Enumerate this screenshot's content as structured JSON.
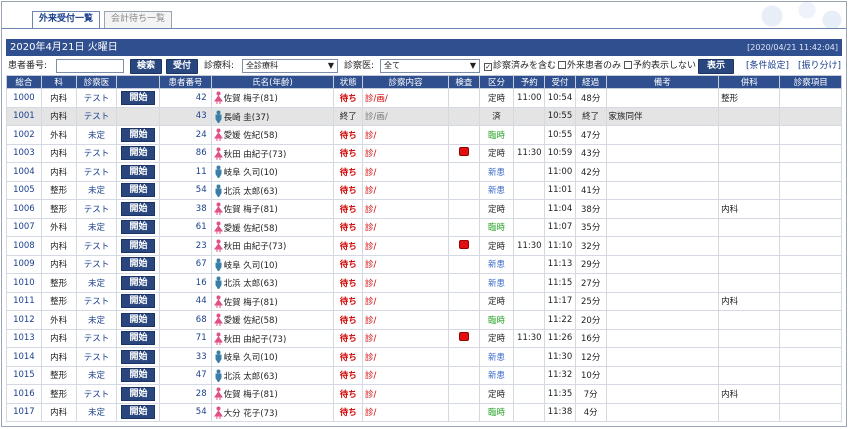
{
  "tabs": [
    {
      "label": "外来受付一覧",
      "active": true
    },
    {
      "label": "会計待ち一覧",
      "active": false
    }
  ],
  "title": "2020年4月21日 火曜日",
  "timestamp": "[2020/04/21 11:42:04]",
  "filter": {
    "patient_no_label": "患者番号:",
    "patient_no_value": "",
    "search_label": "検索",
    "reception_label": "受付",
    "dept_label": "診療科:",
    "dept_value": "全診療科",
    "doctor_label": "診察医:",
    "doctor_value": "全て",
    "cb_include_done": "診察済みを含む",
    "cb_include_done_checked": true,
    "cb_outpatient_only": "外来患者のみ",
    "cb_outpatient_only_checked": false,
    "cb_hide_appointments": "予約表示しない",
    "cb_hide_appointments_checked": false,
    "display_label": "表示",
    "cond_settings": "[条件設定]",
    "allocate": "[振り分け]"
  },
  "columns": [
    "総合",
    "科",
    "診察医",
    "",
    "患者番号",
    "氏名(年齢)",
    "状態",
    "診察内容",
    "検査",
    "区分",
    "予約",
    "受付",
    "経過",
    "備考",
    "併科",
    "診察項目"
  ],
  "start_label": "開始",
  "rows": [
    {
      "no": "1000",
      "dept": "内科",
      "doctor": "テスト",
      "start": true,
      "pid": "42",
      "sex": "f",
      "name": "佐賀 梅子(81)",
      "status": "待ち",
      "content": "診/画/",
      "exam": false,
      "category": "定時",
      "category_type": "normal",
      "appt": "11:00",
      "reception": "10:54",
      "elapsed": "48分",
      "note": "",
      "co_dept": "整形",
      "items": "",
      "done": false
    },
    {
      "no": "1001",
      "dept": "内科",
      "doctor": "テスト",
      "start": false,
      "pid": "43",
      "sex": "m",
      "name": "長崎 圭(37)",
      "status": "終了",
      "content": "診/画/",
      "exam": false,
      "category": "済",
      "category_type": "normal",
      "appt": "",
      "reception": "10:55",
      "elapsed": "終了",
      "note": "家族同伴",
      "co_dept": "",
      "items": "",
      "done": true
    },
    {
      "no": "1002",
      "dept": "外科",
      "doctor": "未定",
      "start": true,
      "pid": "24",
      "sex": "f",
      "name": "愛媛 佐紀(58)",
      "status": "待ち",
      "content": "診/",
      "exam": false,
      "category": "臨時",
      "category_type": "temp",
      "appt": "",
      "reception": "10:55",
      "elapsed": "47分",
      "note": "",
      "co_dept": "",
      "items": "",
      "done": false
    },
    {
      "no": "1003",
      "dept": "内科",
      "doctor": "テスト",
      "start": true,
      "pid": "86",
      "sex": "f",
      "name": "秋田 由紀子(73)",
      "status": "待ち",
      "content": "診/",
      "exam": true,
      "category": "定時",
      "category_type": "normal",
      "appt": "11:30",
      "reception": "10:59",
      "elapsed": "43分",
      "note": "",
      "co_dept": "",
      "items": "",
      "done": false
    },
    {
      "no": "1004",
      "dept": "内科",
      "doctor": "テスト",
      "start": true,
      "pid": "11",
      "sex": "m",
      "name": "岐阜 久司(10)",
      "status": "待ち",
      "content": "診/",
      "exam": false,
      "category": "新患",
      "category_type": "new",
      "appt": "",
      "reception": "11:00",
      "elapsed": "42分",
      "note": "",
      "co_dept": "",
      "items": "",
      "done": false
    },
    {
      "no": "1005",
      "dept": "整形",
      "doctor": "未定",
      "start": true,
      "pid": "54",
      "sex": "m",
      "name": "北浜 太郎(63)",
      "status": "待ち",
      "content": "診/",
      "exam": false,
      "category": "新患",
      "category_type": "new",
      "appt": "",
      "reception": "11:01",
      "elapsed": "41分",
      "note": "",
      "co_dept": "",
      "items": "",
      "done": false
    },
    {
      "no": "1006",
      "dept": "整形",
      "doctor": "テスト",
      "start": true,
      "pid": "38",
      "sex": "f",
      "name": "佐賀 梅子(81)",
      "status": "待ち",
      "content": "診/",
      "exam": false,
      "category": "定時",
      "category_type": "normal",
      "appt": "",
      "reception": "11:04",
      "elapsed": "38分",
      "note": "",
      "co_dept": "内科",
      "items": "",
      "done": false
    },
    {
      "no": "1007",
      "dept": "外科",
      "doctor": "未定",
      "start": true,
      "pid": "61",
      "sex": "f",
      "name": "愛媛 佐紀(58)",
      "status": "待ち",
      "content": "診/",
      "exam": false,
      "category": "臨時",
      "category_type": "temp",
      "appt": "",
      "reception": "11:07",
      "elapsed": "35分",
      "note": "",
      "co_dept": "",
      "items": "",
      "done": false
    },
    {
      "no": "1008",
      "dept": "内科",
      "doctor": "テスト",
      "start": true,
      "pid": "23",
      "sex": "f",
      "name": "秋田 由紀子(73)",
      "status": "待ち",
      "content": "診/",
      "exam": true,
      "category": "定時",
      "category_type": "normal",
      "appt": "11:30",
      "reception": "11:10",
      "elapsed": "32分",
      "note": "",
      "co_dept": "",
      "items": "",
      "done": false
    },
    {
      "no": "1009",
      "dept": "内科",
      "doctor": "テスト",
      "start": true,
      "pid": "67",
      "sex": "m",
      "name": "岐阜 久司(10)",
      "status": "待ち",
      "content": "診/",
      "exam": false,
      "category": "新患",
      "category_type": "new",
      "appt": "",
      "reception": "11:13",
      "elapsed": "29分",
      "note": "",
      "co_dept": "",
      "items": "",
      "done": false
    },
    {
      "no": "1010",
      "dept": "整形",
      "doctor": "未定",
      "start": true,
      "pid": "16",
      "sex": "m",
      "name": "北浜 太郎(63)",
      "status": "待ち",
      "content": "診/",
      "exam": false,
      "category": "新患",
      "category_type": "new",
      "appt": "",
      "reception": "11:15",
      "elapsed": "27分",
      "note": "",
      "co_dept": "",
      "items": "",
      "done": false
    },
    {
      "no": "1011",
      "dept": "整形",
      "doctor": "テスト",
      "start": true,
      "pid": "44",
      "sex": "f",
      "name": "佐賀 梅子(81)",
      "status": "待ち",
      "content": "診/",
      "exam": false,
      "category": "定時",
      "category_type": "normal",
      "appt": "",
      "reception": "11:17",
      "elapsed": "25分",
      "note": "",
      "co_dept": "内科",
      "items": "",
      "done": false
    },
    {
      "no": "1012",
      "dept": "外科",
      "doctor": "未定",
      "start": true,
      "pid": "68",
      "sex": "f",
      "name": "愛媛 佐紀(58)",
      "status": "待ち",
      "content": "診/",
      "exam": false,
      "category": "臨時",
      "category_type": "temp",
      "appt": "",
      "reception": "11:22",
      "elapsed": "20分",
      "note": "",
      "co_dept": "",
      "items": "",
      "done": false
    },
    {
      "no": "1013",
      "dept": "内科",
      "doctor": "テスト",
      "start": true,
      "pid": "71",
      "sex": "f",
      "name": "秋田 由紀子(73)",
      "status": "待ち",
      "content": "診/",
      "exam": true,
      "category": "定時",
      "category_type": "normal",
      "appt": "11:30",
      "reception": "11:26",
      "elapsed": "16分",
      "note": "",
      "co_dept": "",
      "items": "",
      "done": false
    },
    {
      "no": "1014",
      "dept": "内科",
      "doctor": "テスト",
      "start": true,
      "pid": "33",
      "sex": "m",
      "name": "岐阜 久司(10)",
      "status": "待ち",
      "content": "診/",
      "exam": false,
      "category": "新患",
      "category_type": "new",
      "appt": "",
      "reception": "11:30",
      "elapsed": "12分",
      "note": "",
      "co_dept": "",
      "items": "",
      "done": false
    },
    {
      "no": "1015",
      "dept": "整形",
      "doctor": "未定",
      "start": true,
      "pid": "47",
      "sex": "m",
      "name": "北浜 太郎(63)",
      "status": "待ち",
      "content": "診/",
      "exam": false,
      "category": "新患",
      "category_type": "new",
      "appt": "",
      "reception": "11:32",
      "elapsed": "10分",
      "note": "",
      "co_dept": "",
      "items": "",
      "done": false
    },
    {
      "no": "1016",
      "dept": "整形",
      "doctor": "テスト",
      "start": true,
      "pid": "28",
      "sex": "f",
      "name": "佐賀 梅子(81)",
      "status": "待ち",
      "content": "診/",
      "exam": false,
      "category": "定時",
      "category_type": "normal",
      "appt": "",
      "reception": "11:35",
      "elapsed": "7分",
      "note": "",
      "co_dept": "内科",
      "items": "",
      "done": false
    },
    {
      "no": "1017",
      "dept": "内科",
      "doctor": "未定",
      "start": true,
      "pid": "54",
      "sex": "f",
      "name": "大分 花子(73)",
      "status": "待ち",
      "content": "診/",
      "exam": false,
      "category": "臨時",
      "category_type": "temp",
      "appt": "",
      "reception": "11:38",
      "elapsed": "4分",
      "note": "",
      "co_dept": "",
      "items": "",
      "done": false
    }
  ],
  "colors": {
    "header_bg": "#2f4f8f",
    "wait_red": "#d00000",
    "temp_green": "#2aa52a",
    "new_blue": "#3a68c8",
    "female_pink": "#e0508a",
    "male_blue": "#3b7fa8"
  }
}
